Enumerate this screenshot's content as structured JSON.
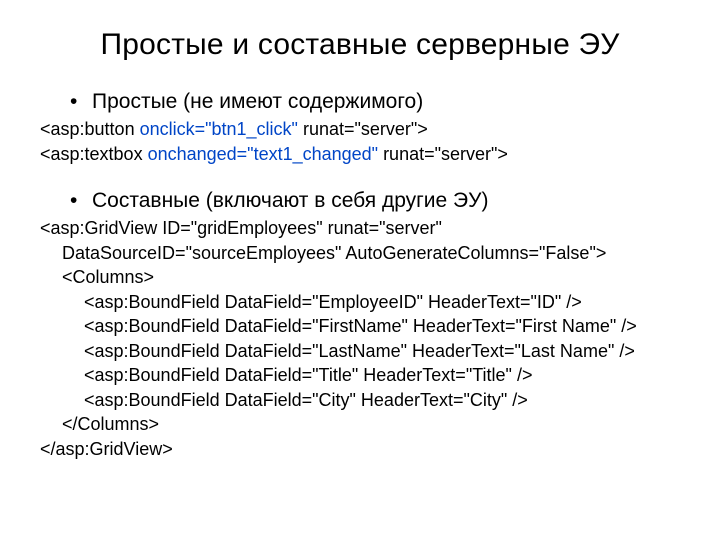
{
  "title": "Простые и составные серверные ЭУ",
  "bullet1": "Простые (не имеют содержимого)",
  "line1": {
    "a": "<asp:button ",
    "b": "onclick=\"btn1_click\"",
    "c": " runat=\"server\">"
  },
  "line2": {
    "a": "<asp:textbox ",
    "b": "onchanged=\"text1_changed\"",
    "c": " runat=\"server\">"
  },
  "bullet2": "Составные (включают в себя другие ЭУ)",
  "grid1": "<asp:GridView ID=\"gridEmployees\" runat=\"server\"",
  "grid2": "DataSourceID=\"sourceEmployees\" AutoGenerateColumns=\"False\">",
  "colsOpen": "<Columns>",
  "f1": "<asp:BoundField DataField=\"EmployeeID\" HeaderText=\"ID\" />",
  "f2": "<asp:BoundField DataField=\"FirstName\" HeaderText=\"First Name\" />",
  "f3": "<asp:BoundField DataField=\"LastName\" HeaderText=\"Last Name\" />",
  "f4": "<asp:BoundField DataField=\"Title\" HeaderText=\"Title\" />",
  "f5": "<asp:BoundField DataField=\"City\" HeaderText=\"City\" />",
  "colsClose": "</Columns>",
  "gridClose": "</asp:GridView>"
}
